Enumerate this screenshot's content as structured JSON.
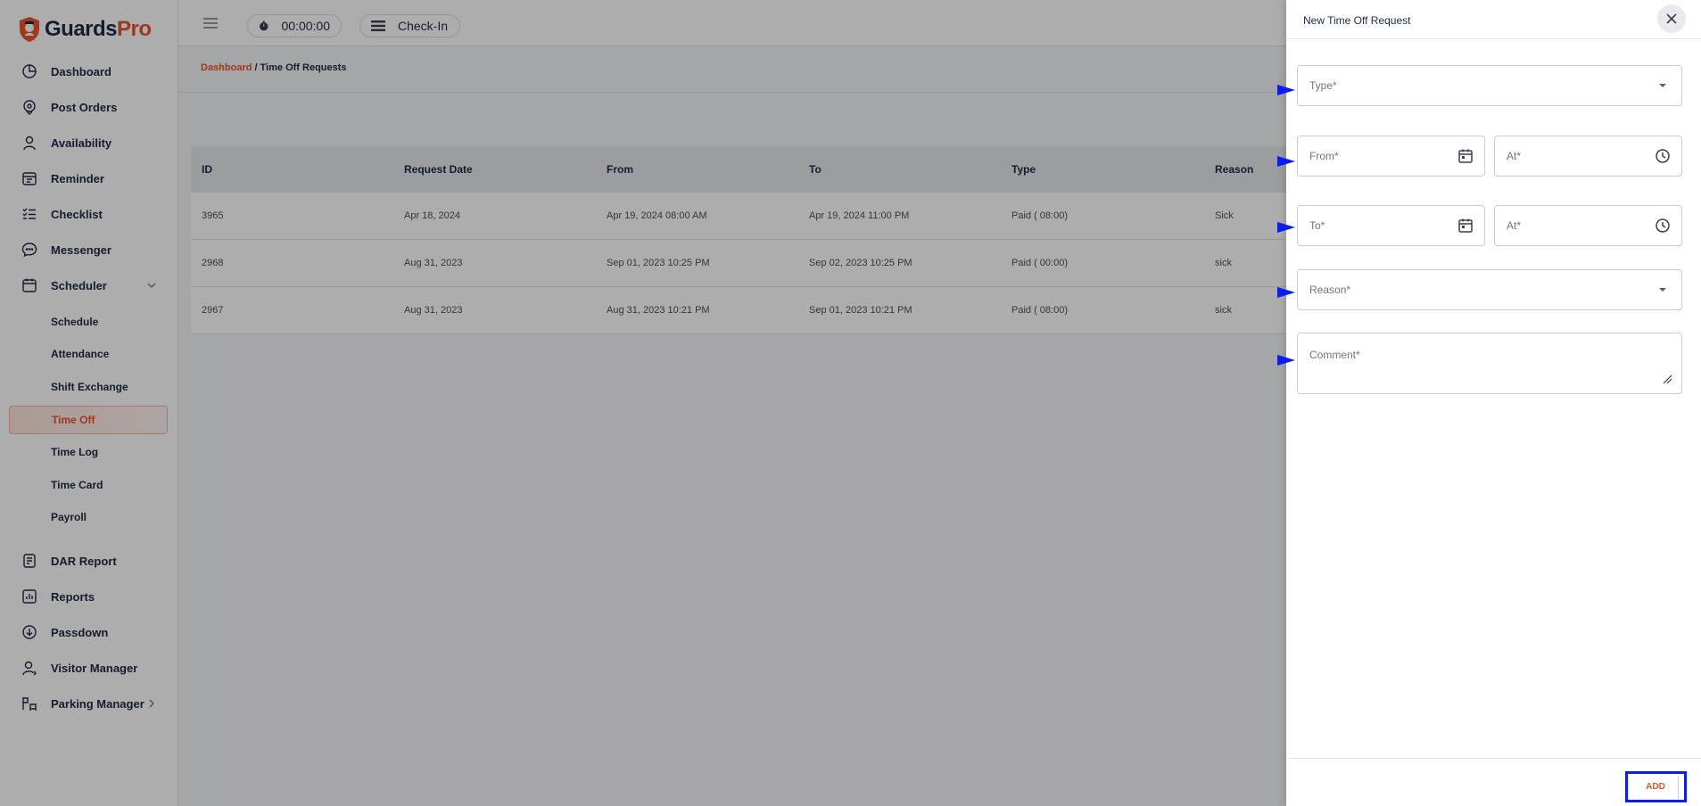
{
  "app": {
    "brand_first": "Guards",
    "brand_second": "Pro"
  },
  "topbar": {
    "timer": "00:00:00",
    "checkin_label": "Check-In"
  },
  "sidebar": {
    "items": [
      {
        "label": "Dashboard",
        "icon": "dashboard-icon"
      },
      {
        "label": "Post Orders",
        "icon": "post-orders-icon"
      },
      {
        "label": "Availability",
        "icon": "user-icon"
      },
      {
        "label": "Reminder",
        "icon": "reminder-icon"
      },
      {
        "label": "Checklist",
        "icon": "checklist-icon"
      },
      {
        "label": "Messenger",
        "icon": "chat-icon"
      },
      {
        "label": "Scheduler",
        "icon": "calendar-icon"
      }
    ],
    "scheduler_sub": [
      "Schedule",
      "Attendance",
      "Shift Exchange",
      "Time Off",
      "Time Log",
      "Time Card",
      "Payroll"
    ],
    "active_sub": "Time Off",
    "bottom_items": [
      {
        "label": "DAR Report",
        "icon": "report-icon"
      },
      {
        "label": "Reports",
        "icon": "reports-icon"
      },
      {
        "label": "Passdown",
        "icon": "passdown-icon"
      },
      {
        "label": "Visitor Manager",
        "icon": "visitor-icon"
      },
      {
        "label": "Parking Manager",
        "icon": "parking-icon"
      }
    ]
  },
  "breadcrumb": {
    "link": "Dashboard",
    "separator": "/",
    "current": "Time Off Requests"
  },
  "table": {
    "headers": [
      "ID",
      "Request Date",
      "From",
      "To",
      "Type",
      "Reason"
    ],
    "rows": [
      [
        "3965",
        "Apr 18, 2024",
        "Apr 19, 2024 08:00 AM",
        "Apr 19, 2024 11:00 PM",
        "Paid ( 08:00)",
        "Sick"
      ],
      [
        "2968",
        "Aug 31, 2023",
        "Sep 01, 2023 10:25 PM",
        "Sep 02, 2023 10:25 PM",
        "Paid ( 00:00)",
        "sick"
      ],
      [
        "2967",
        "Aug 31, 2023",
        "Aug 31, 2023 10:21 PM",
        "Sep 01, 2023 10:21 PM",
        "Paid ( 08:00)",
        "sick"
      ]
    ]
  },
  "drawer": {
    "title": "New Time Off Request",
    "fields": {
      "type": "Type*",
      "from": "From*",
      "from_at": "At*",
      "to": "To*",
      "to_at": "At*",
      "reason": "Reason*",
      "comment": "Comment*"
    },
    "add_label": "ADD"
  },
  "colors": {
    "accent": "#e8542c",
    "highlight": "#0a1cf0",
    "overlay": "rgba(0,0,0,0.32)"
  }
}
